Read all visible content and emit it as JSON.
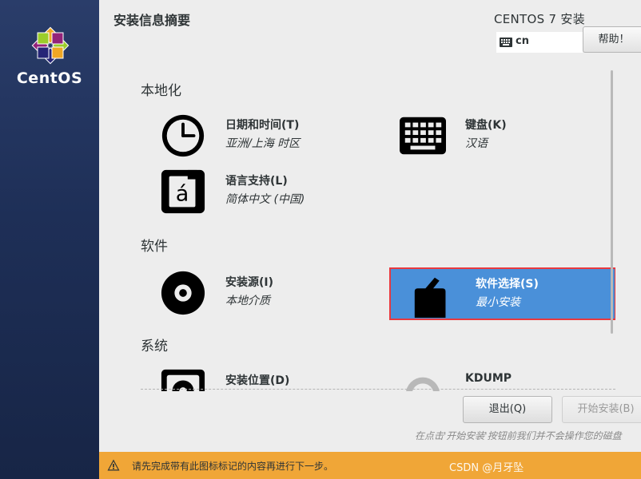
{
  "brand": {
    "name": "CentOS"
  },
  "header": {
    "title": "安装信息摘要",
    "product": "CENTOS 7 安装",
    "keyboard_layout": "cn",
    "help_label": "帮助！"
  },
  "sections": {
    "localization": "本地化",
    "software": "软件",
    "system": "系统"
  },
  "spokes": {
    "datetime": {
      "title": "日期和时间(T)",
      "status": "亚洲/上海 时区",
      "icon": "clock-icon"
    },
    "keyboard": {
      "title": "键盘(K)",
      "status": "汉语",
      "icon": "keyboard-icon"
    },
    "language": {
      "title": "语言支持(L)",
      "status": "简体中文 (中国)",
      "icon": "language-icon",
      "glyph": "á"
    },
    "source": {
      "title": "安装源(I)",
      "status": "本地介质",
      "icon": "disc-icon"
    },
    "software": {
      "title": "软件选择(S)",
      "status": "最小安装",
      "icon": "package-icon",
      "selected": true
    },
    "destination": {
      "title": "安装位置(D)",
      "icon": "harddisk-icon"
    },
    "kdump": {
      "title": "KDUMP",
      "icon": "kdump-icon"
    }
  },
  "footer": {
    "quit_label": "退出(Q)",
    "begin_label": "开始安装(B)",
    "note": "在点击'开始安装'按钮前我们并不会操作您的磁盘",
    "warning": "请先完成带有此图标标记的内容再进行下一步。",
    "watermark": "CSDN @月牙坠"
  },
  "colors": {
    "sidebar": "#1e2f57",
    "selected": "#4a90d9",
    "highlight_border": "#e8393f",
    "warning_bar": "#f0a637"
  }
}
